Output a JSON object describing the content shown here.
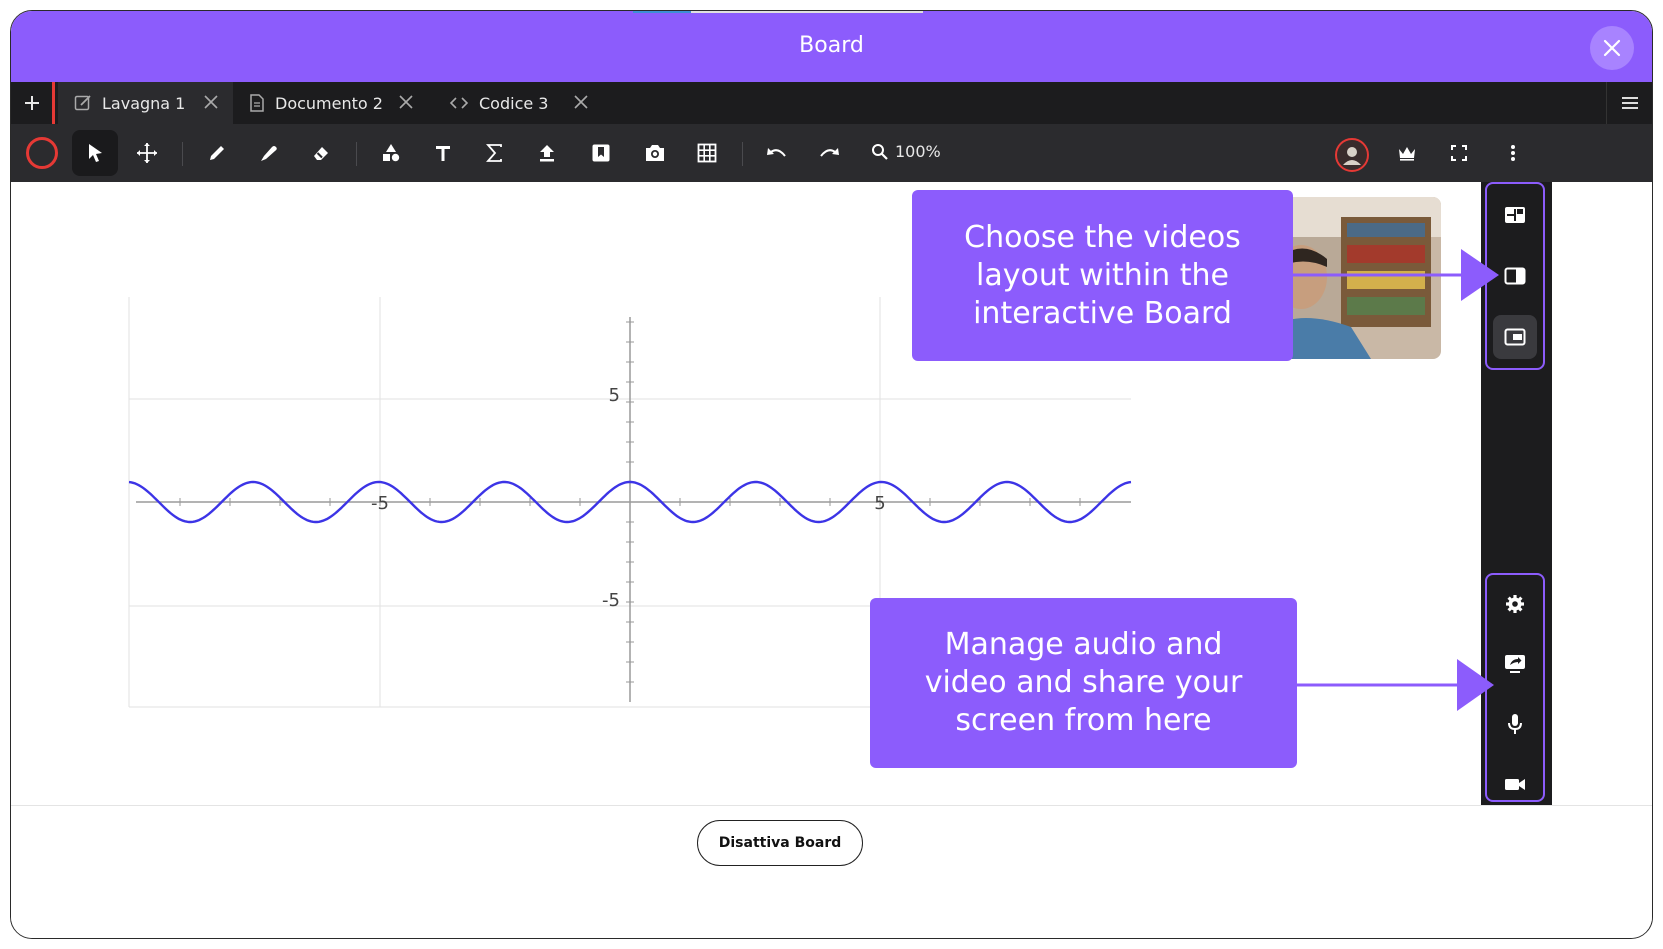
{
  "window": {
    "title": "Board",
    "accent_color": "#8c5cfc"
  },
  "tabs": [
    {
      "label": "Lavagna 1",
      "icon": "edit-icon",
      "active": true
    },
    {
      "label": "Documento 2",
      "icon": "document-icon",
      "active": false
    },
    {
      "label": "Codice 3",
      "icon": "code-icon",
      "active": false
    }
  ],
  "toolbar": {
    "tools": [
      "record-icon",
      "select-arrow-icon",
      "move-icon",
      "pen-icon",
      "highlighter-icon",
      "eraser-icon",
      "shapes-icon",
      "text-icon",
      "sigma-icon",
      "upload-icon",
      "bookmark-icon",
      "camera-icon",
      "grid-icon",
      "undo-icon",
      "redo-icon"
    ],
    "zoom": "100%",
    "right": [
      "avatar",
      "crown-icon",
      "fullscreen-icon",
      "more-vertical-icon"
    ]
  },
  "graph": {
    "function": "sine",
    "x_ticks": [
      "-5",
      "5"
    ],
    "y_ticks": [
      "5",
      "-5"
    ],
    "curve_color": "#3c34e6"
  },
  "side_panel": {
    "layout_buttons": [
      "grid-layout-icon",
      "side-layout-icon",
      "pip-layout-icon"
    ],
    "media_buttons": [
      "settings-icon",
      "share-screen-icon",
      "microphone-icon",
      "video-camera-icon"
    ]
  },
  "callouts": {
    "layout": "Choose the videos\nlayout within the\ninteractive Board",
    "media": "Manage audio and\nvideo and share your\nscreen from here"
  },
  "footer": {
    "button_label": "Disattiva Board"
  }
}
